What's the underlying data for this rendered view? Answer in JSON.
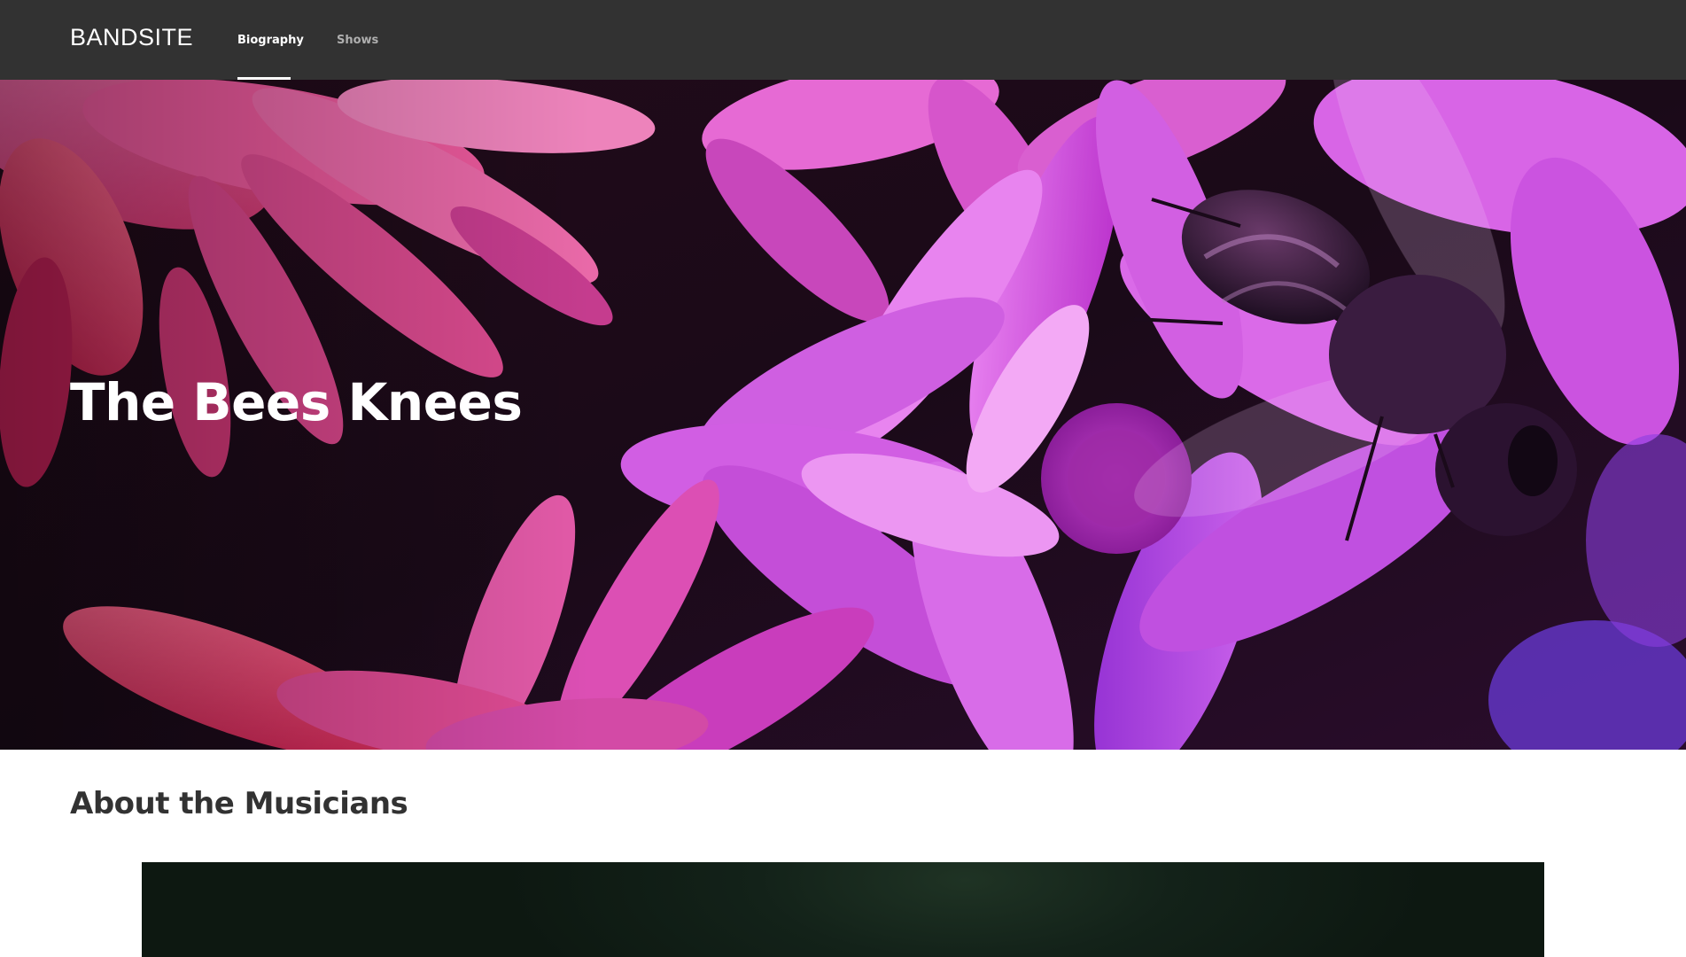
{
  "header": {
    "logo": "BANDSITE",
    "nav": [
      {
        "label": "Biography",
        "active": true
      },
      {
        "label": "Shows",
        "active": false
      }
    ]
  },
  "hero": {
    "title": "The Bees Knees"
  },
  "about": {
    "title": "About the Musicians"
  },
  "colors": {
    "header_bg": "#323232",
    "nav_active": "#ffffff",
    "nav_inactive": "#afafaf",
    "heading_text": "#323232",
    "hero_magenta": "#c236d6",
    "hero_pink": "#f0407a"
  }
}
